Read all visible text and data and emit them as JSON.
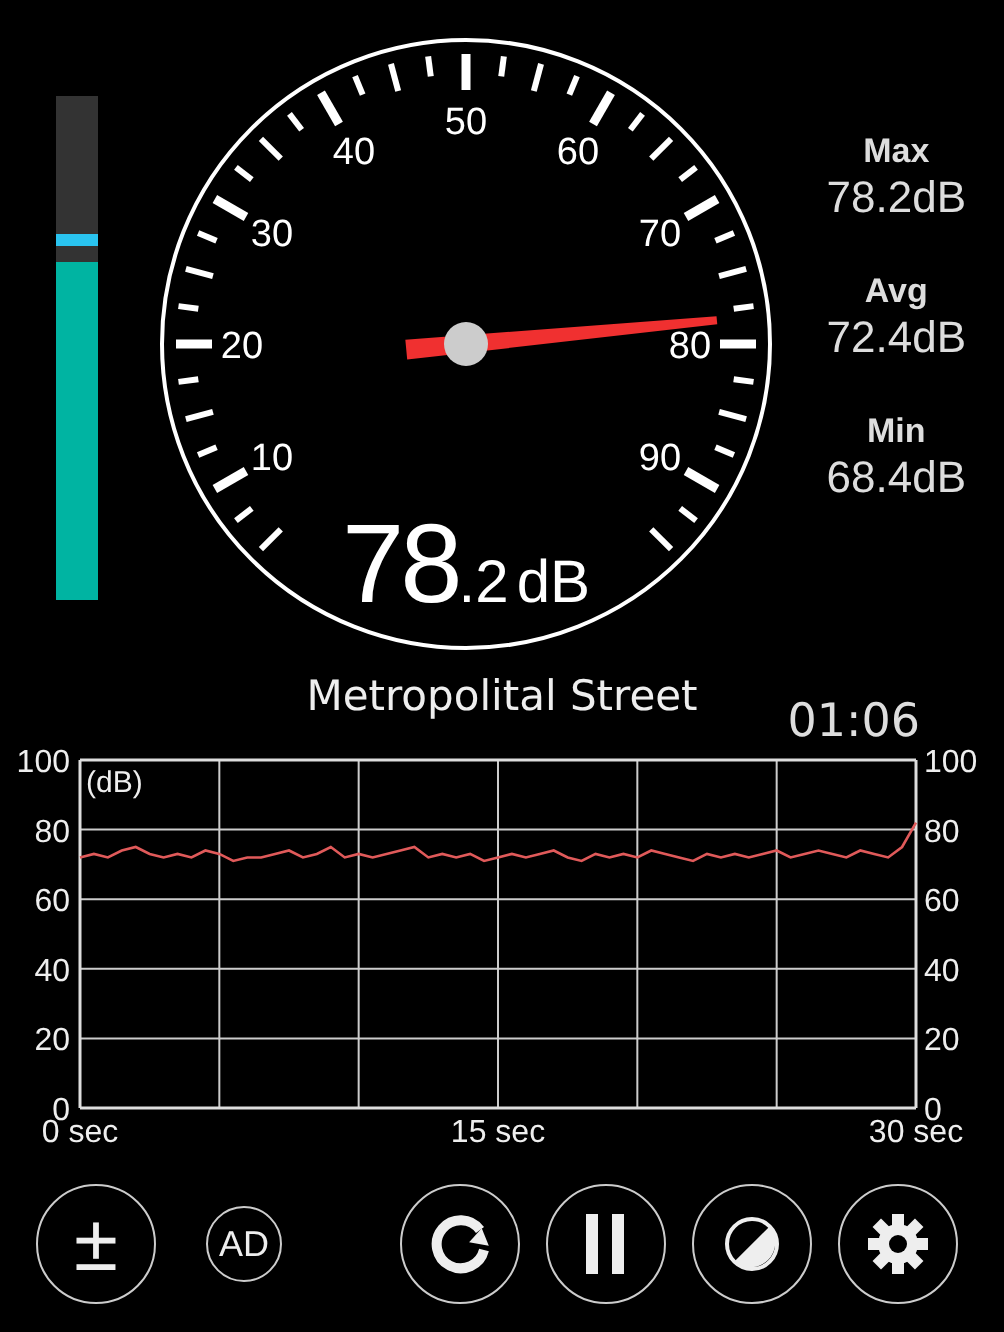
{
  "level_meter": {
    "level": 0.67
  },
  "gauge": {
    "scale_labels": [
      "10",
      "20",
      "30",
      "40",
      "50",
      "60",
      "70",
      "80",
      "90"
    ],
    "reading_whole": "78",
    "reading_decimal": ".2",
    "reading_unit": "dB"
  },
  "stats": [
    {
      "label": "Max",
      "value": "78.2dB"
    },
    {
      "label": "Avg",
      "value": "72.4dB"
    },
    {
      "label": "Min",
      "value": "68.4dB"
    }
  ],
  "location": "Metropolital Street",
  "elapsed": "01:06",
  "chart": {
    "chart_data": {
      "type": "line",
      "ylabel": "(dB)",
      "xlim": [
        0,
        30
      ],
      "ylim": [
        0,
        100
      ],
      "yticks": [
        0,
        20,
        40,
        60,
        80,
        100
      ],
      "y2ticks": [
        0,
        20,
        40,
        60,
        80,
        100
      ],
      "y2lim": [
        0,
        100
      ],
      "grid": true,
      "xticks": [
        {
          "value": 0,
          "label": "0 sec"
        },
        {
          "value": 15,
          "label": "15 sec"
        },
        {
          "value": 30,
          "label": "30 sec"
        }
      ],
      "x": [
        0,
        0.5,
        1,
        1.5,
        2,
        2.5,
        3,
        3.5,
        4,
        4.5,
        5,
        5.5,
        6,
        6.5,
        7,
        7.5,
        8,
        8.5,
        9,
        9.5,
        10,
        10.5,
        11,
        11.5,
        12,
        12.5,
        13,
        13.5,
        14,
        14.5,
        15,
        15.5,
        16,
        16.5,
        17,
        17.5,
        18,
        18.5,
        19,
        19.5,
        20,
        20.5,
        21,
        21.5,
        22,
        22.5,
        23,
        23.5,
        24,
        24.5,
        25,
        25.5,
        26,
        26.5,
        27,
        27.5,
        28,
        28.5,
        29,
        29.5,
        30
      ],
      "series": [
        {
          "color": "#e05a5a",
          "values": [
            72,
            73,
            72,
            74,
            75,
            73,
            72,
            73,
            72,
            74,
            73,
            71,
            72,
            72,
            73,
            74,
            72,
            73,
            75,
            72,
            73,
            72,
            73,
            74,
            75,
            72,
            73,
            72,
            73,
            71,
            72,
            73,
            72,
            73,
            74,
            72,
            71,
            73,
            72,
            73,
            72,
            74,
            73,
            72,
            71,
            73,
            72,
            73,
            72,
            73,
            74,
            72,
            73,
            74,
            73,
            72,
            74,
            73,
            72,
            75,
            82
          ]
        }
      ]
    }
  },
  "buttons": [
    {
      "kind": "calibrate",
      "label": "±"
    },
    {
      "kind": "ad",
      "label": "AD"
    },
    {
      "kind": "reset"
    },
    {
      "kind": "pause"
    },
    {
      "kind": "theme"
    },
    {
      "kind": "settings"
    }
  ]
}
